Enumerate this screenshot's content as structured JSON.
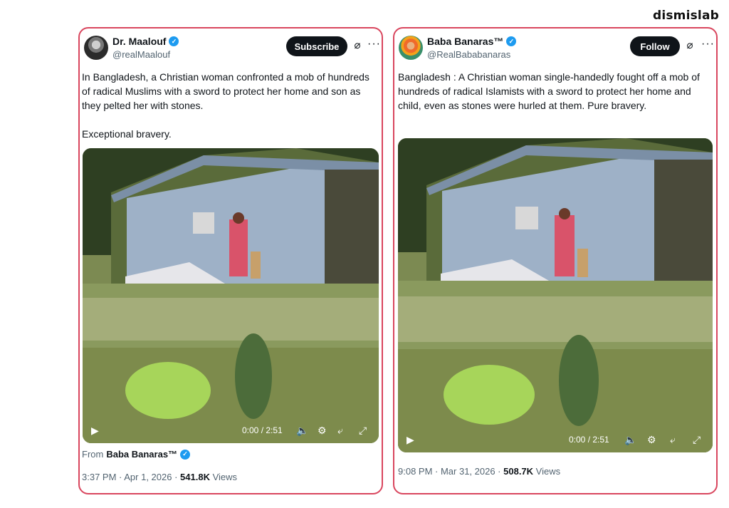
{
  "brand": "dismislab",
  "tweets": [
    {
      "name": "Dr. Maalouf",
      "handle": "@realMaalouf",
      "action": "Subscribe",
      "text": "In Bangladesh, a Christian woman confronted a mob of hundreds of radical Muslims with a sword to protect her home and son as they pelted her with stones.\n\nExceptional bravery.",
      "video_time": "0:00 / 2:51",
      "from_label": "From",
      "from_name": "Baba Banaras™",
      "time": "3:37 PM · Apr 1, 2026 · ",
      "views_count": "541.8K",
      "views_label": " Views"
    },
    {
      "name": "Baba Banaras™",
      "handle": "@RealBababanaras",
      "action": "Follow",
      "text": "Bangladesh : A Christian woman single-handedly fought off a mob of hundreds of radical Islamists with a sword to protect her home and child, even as stones were hurled at them. Pure bravery.",
      "video_time": "0:00 / 2:51",
      "time": "9:08 PM · Mar 31, 2026 · ",
      "views_count": "508.7K",
      "views_label": " Views"
    }
  ],
  "icons": [
    "verified-badge-icon",
    "grok-icon",
    "more-icon",
    "play-icon",
    "volume-icon",
    "settings-icon",
    "rotate-icon",
    "fullscreen-icon"
  ],
  "colors": {
    "highlight_border": "#d9465e",
    "verified": "#1d9bf0",
    "button": "#0f1419"
  }
}
